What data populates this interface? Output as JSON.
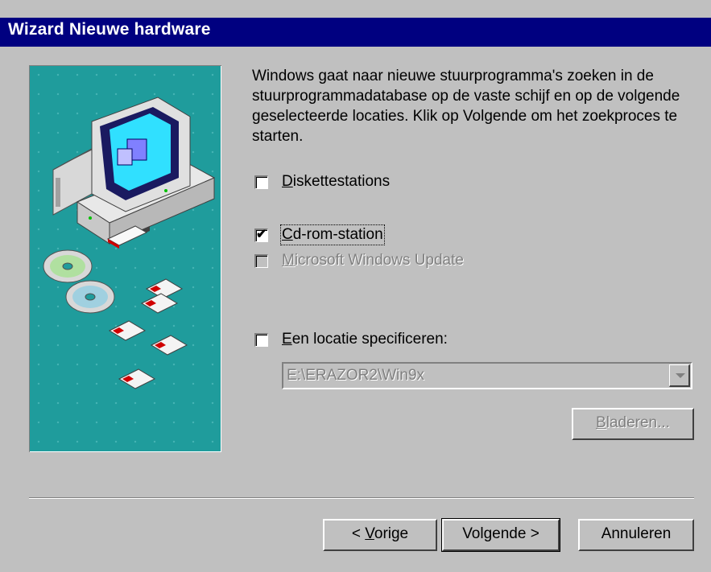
{
  "window": {
    "title": "Wizard Nieuwe hardware"
  },
  "intro": "Windows gaat naar nieuwe stuurprogramma's zoeken in de stuurprogrammadatabase op de vaste schijf en op de volgende geselecteerde locaties. Klik op Volgende om het zoekproces te starten.",
  "options": {
    "floppy": {
      "mnemonic": "D",
      "rest": "iskettestations",
      "checked": false,
      "enabled": true
    },
    "cdrom": {
      "mnemonic": "C",
      "rest": "d-rom-station",
      "checked": true,
      "enabled": true
    },
    "windows_update": {
      "mnemonic": "M",
      "rest": "icrosoft Windows Update",
      "checked": false,
      "enabled": false
    },
    "location": {
      "mnemonic": "E",
      "rest": "en locatie specificeren:",
      "checked": false,
      "enabled": true
    }
  },
  "location_path": {
    "value": "E:\\ERAZOR2\\Win9x",
    "enabled": false
  },
  "browse": {
    "mnemonic": "B",
    "rest": "laderen...",
    "enabled": false
  },
  "buttons": {
    "back": {
      "prefix": "< ",
      "mnemonic": "V",
      "rest": "orige"
    },
    "next": "Volgende >",
    "cancel": "Annuleren"
  },
  "colors": {
    "titlebar": "#000080",
    "face": "#c0c0c0",
    "illustration_bg": "#1f9c9c"
  },
  "icons": [
    "computer-illustration",
    "cd-rom-discs-icon",
    "floppy-disk-icon",
    "check-mark-icon",
    "dropdown-arrow-icon"
  ]
}
